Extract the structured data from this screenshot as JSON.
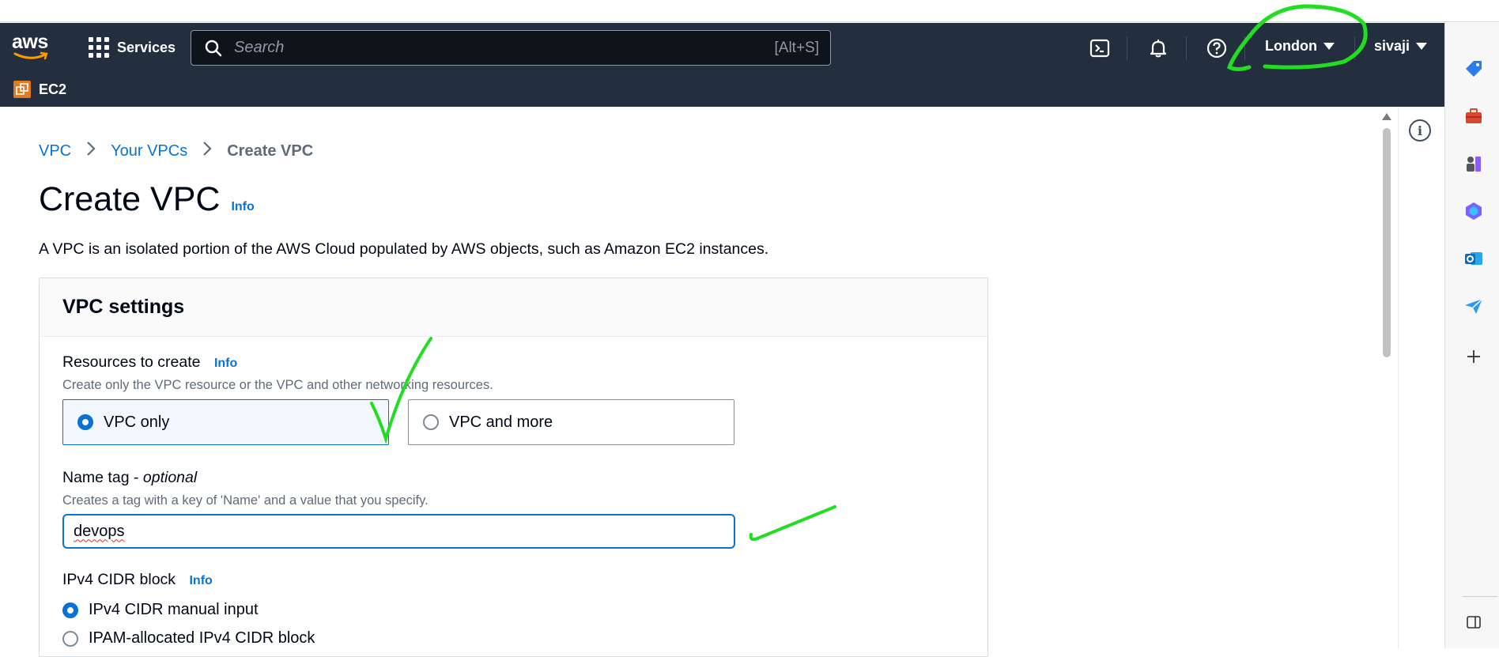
{
  "nav": {
    "logo_text": "aws",
    "services_label": "Services",
    "search_placeholder": "Search",
    "search_shortcut": "[Alt+S]",
    "region_label": "London",
    "user_label": "sivaji",
    "service_label": "EC2"
  },
  "breadcrumb": {
    "items": [
      "VPC",
      "Your VPCs"
    ],
    "current": "Create VPC"
  },
  "page": {
    "title": "Create VPC",
    "info_label": "Info",
    "description": "A VPC is an isolated portion of the AWS Cloud populated by AWS objects, such as Amazon EC2 instances."
  },
  "vpc_settings": {
    "heading": "VPC settings",
    "resources": {
      "label": "Resources to create",
      "info_label": "Info",
      "description": "Create only the VPC resource or the VPC and other networking resources.",
      "options": [
        "VPC only",
        "VPC and more"
      ],
      "selected": "VPC only"
    },
    "name_tag": {
      "label": "Name tag - ",
      "label_optional": "optional",
      "description": "Creates a tag with a key of 'Name' and a value that you specify.",
      "value": "devops"
    },
    "ipv4": {
      "label": "IPv4 CIDR block",
      "info_label": "Info",
      "options": [
        "IPv4 CIDR manual input",
        "IPAM-allocated IPv4 CIDR block"
      ],
      "selected": "IPv4 CIDR manual input"
    }
  },
  "colors": {
    "nav_bg": "#232f3e",
    "link": "#0972d3",
    "annotation_green": "#22dd22"
  }
}
